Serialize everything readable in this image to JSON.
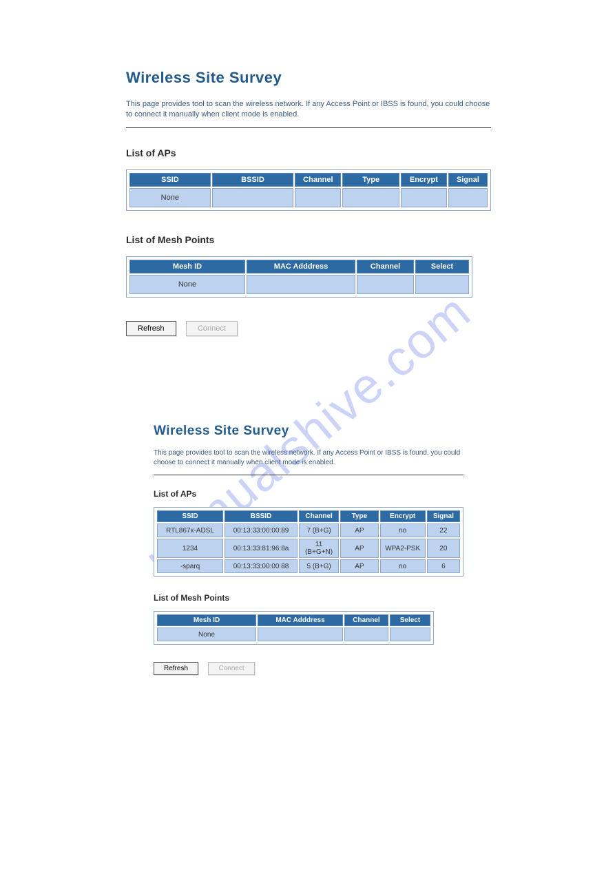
{
  "watermark": "manualshive.com",
  "panel1": {
    "title": "Wireless Site Survey",
    "description": "This page provides tool to scan the wireless network. If any Access Point or IBSS is found, you could choose to connect it manually when client mode is enabled.",
    "aps_title": "List of APs",
    "aps_headers": [
      "SSID",
      "BSSID",
      "Channel",
      "Type",
      "Encrypt",
      "Signal"
    ],
    "aps_none": "None",
    "mesh_title": "List of Mesh Points",
    "mesh_headers": [
      "Mesh ID",
      "MAC Adddress",
      "Channel",
      "Select"
    ],
    "mesh_none": "None",
    "refresh_label": "Refresh",
    "connect_label": "Connect"
  },
  "panel2": {
    "title": "Wireless Site Survey",
    "description": "This page provides tool to scan the wireless network. If any Access Point or IBSS is found, you could choose to connect it manually when client mode is enabled.",
    "aps_title": "List of APs",
    "aps_headers": [
      "SSID",
      "BSSID",
      "Channel",
      "Type",
      "Encrypt",
      "Signal"
    ],
    "aps_rows": [
      {
        "ssid": "RTL867x-ADSL",
        "bssid": "00:13:33:00:00:89",
        "channel": "7 (B+G)",
        "type": "AP",
        "encrypt": "no",
        "signal": "22"
      },
      {
        "ssid": "1234",
        "bssid": "00:13:33:81:96:8a",
        "channel": "11 (B+G+N)",
        "type": "AP",
        "encrypt": "WPA2-PSK",
        "signal": "20"
      },
      {
        "ssid": "-sparq",
        "bssid": "00:13:33:00:00:88",
        "channel": "5 (B+G)",
        "type": "AP",
        "encrypt": "no",
        "signal": "6"
      }
    ],
    "mesh_title": "List of Mesh Points",
    "mesh_headers": [
      "Mesh ID",
      "MAC Adddress",
      "Channel",
      "Select"
    ],
    "mesh_none": "None",
    "refresh_label": "Refresh",
    "connect_label": "Connect"
  }
}
